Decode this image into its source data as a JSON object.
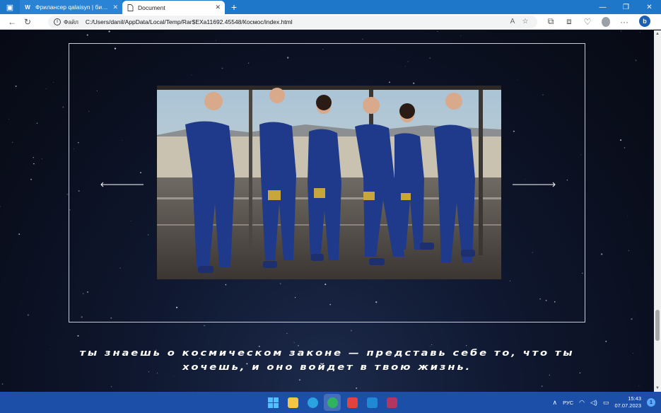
{
  "browser": {
    "tabs": [
      {
        "icon": "W",
        "title": "Фрилансер qalaisyn | биржа фр",
        "active": false
      },
      {
        "icon": "document-icon",
        "title": "Document",
        "active": true
      }
    ],
    "new_tab_symbol": "+",
    "address": {
      "scheme_label": "Файл",
      "url": "C:/Users/danil/AppData/Local/Temp/Rar$EXa11692.45548/Космос/index.html",
      "reader_mode_label": "A"
    }
  },
  "page": {
    "slider": {
      "image_alt": "Экипаж в синих космических костюмах",
      "prev_label": "предыдущий слайд",
      "next_label": "следующий слайд"
    },
    "tagline": {
      "line1": "ты знаешь о космическом законе — представь себе то, что ты",
      "line2": "хочешь, и оно войдет в твою жизнь."
    },
    "colors": {
      "accent_frame": "#c7ccd6",
      "background": "#0a0f1e",
      "suit": "#1f3a8a"
    }
  },
  "taskbar": {
    "apps": [
      {
        "name": "start",
        "color": "#4cc2ff",
        "active": false
      },
      {
        "name": "file-explorer",
        "color": "#f4c542",
        "active": false
      },
      {
        "name": "telegram",
        "color": "#2aa3e0",
        "active": false
      },
      {
        "name": "edge",
        "color": "#2fb35f",
        "active": true
      },
      {
        "name": "app-red",
        "color": "#e0433a",
        "active": false
      },
      {
        "name": "vscode",
        "color": "#1e8ad6",
        "active": false
      },
      {
        "name": "winrar",
        "color": "#b2365d",
        "active": false
      }
    ],
    "tray": {
      "language": "РУС",
      "time": "15:43",
      "date": "07.07.2023",
      "notifications": "1"
    }
  }
}
